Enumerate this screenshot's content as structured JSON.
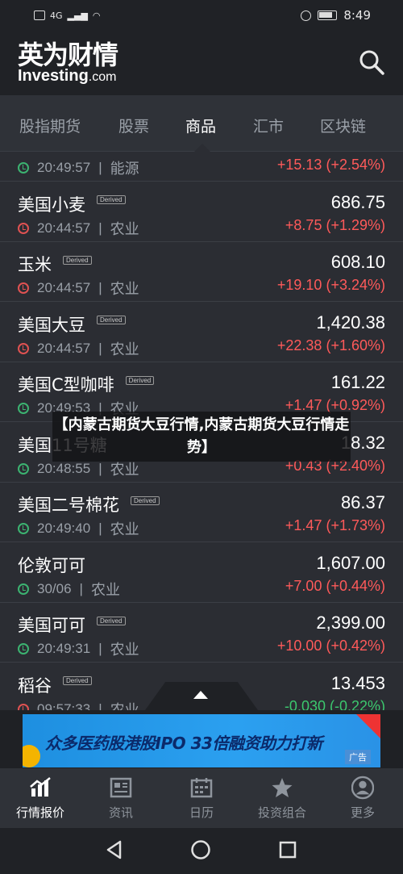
{
  "status_bar": {
    "signal": "4G",
    "time": "8:49"
  },
  "header": {
    "logo_cn": "英为财情",
    "logo_en_main": "Investing",
    "logo_en_suffix": ".com"
  },
  "tabs": [
    {
      "label": "股指期货",
      "active": false
    },
    {
      "label": "股票",
      "active": false
    },
    {
      "label": "商品",
      "active": true
    },
    {
      "label": "汇市",
      "active": false
    },
    {
      "label": "区块链",
      "active": false
    }
  ],
  "rows": [
    {
      "name": "",
      "derived": false,
      "time": "20:49:57",
      "category": "能源",
      "price": "",
      "change": "+15.13 (+2.54%)",
      "direction": "up",
      "clock": "green"
    },
    {
      "name": "美国小麦",
      "derived": true,
      "time": "20:44:57",
      "category": "农业",
      "price": "686.75",
      "change": "+8.75 (+1.29%)",
      "direction": "up",
      "clock": "red"
    },
    {
      "name": "玉米",
      "derived": true,
      "time": "20:44:57",
      "category": "农业",
      "price": "608.10",
      "change": "+19.10 (+3.24%)",
      "direction": "up",
      "clock": "red"
    },
    {
      "name": "美国大豆",
      "derived": true,
      "time": "20:44:57",
      "category": "农业",
      "price": "1,420.38",
      "change": "+22.38 (+1.60%)",
      "direction": "up",
      "clock": "red"
    },
    {
      "name": "美国C型咖啡",
      "derived": true,
      "time": "20:49:53",
      "category": "农业",
      "price": "161.22",
      "change": "+1.47 (+0.92%)",
      "direction": "up",
      "clock": "green"
    },
    {
      "name": "美国11号糖",
      "derived": false,
      "time": "20:48:55",
      "category": "农业",
      "price": "18.32",
      "change": "+0.43 (+2.40%)",
      "direction": "up",
      "clock": "green"
    },
    {
      "name": "美国二号棉花",
      "derived": true,
      "time": "20:49:40",
      "category": "农业",
      "price": "86.37",
      "change": "+1.47 (+1.73%)",
      "direction": "up",
      "clock": "green"
    },
    {
      "name": "伦敦可可",
      "derived": false,
      "time": "30/06",
      "category": "农业",
      "price": "1,607.00",
      "change": "+7.00 (+0.44%)",
      "direction": "up",
      "clock": "green"
    },
    {
      "name": "美国可可",
      "derived": true,
      "time": "20:49:31",
      "category": "农业",
      "price": "2,399.00",
      "change": "+10.00 (+0.42%)",
      "direction": "up",
      "clock": "green"
    },
    {
      "name": "稻谷",
      "derived": true,
      "time": "09:57:33",
      "category": "农业",
      "price": "13.453",
      "change": "-0.030 (-0.22%)",
      "direction": "down",
      "clock": "red"
    }
  ],
  "derived_label": "Derived",
  "overlay_text": "【内蒙古期货大豆行情,内蒙古期货大豆行情走势】",
  "ad": {
    "text": "众多医药股港股IPO 33倍融资助力打新",
    "tag": "广告"
  },
  "bottom_nav": [
    {
      "label": "行情报价",
      "icon": "chart-icon",
      "active": true
    },
    {
      "label": "资讯",
      "icon": "news-icon",
      "active": false
    },
    {
      "label": "日历",
      "icon": "calendar-icon",
      "active": false
    },
    {
      "label": "投资组合",
      "icon": "star-icon",
      "active": false
    },
    {
      "label": "更多",
      "icon": "profile-icon",
      "active": false
    }
  ],
  "colors": {
    "up": "#ff5a5a",
    "down": "#3cc86e",
    "background": "#2b2d33"
  }
}
